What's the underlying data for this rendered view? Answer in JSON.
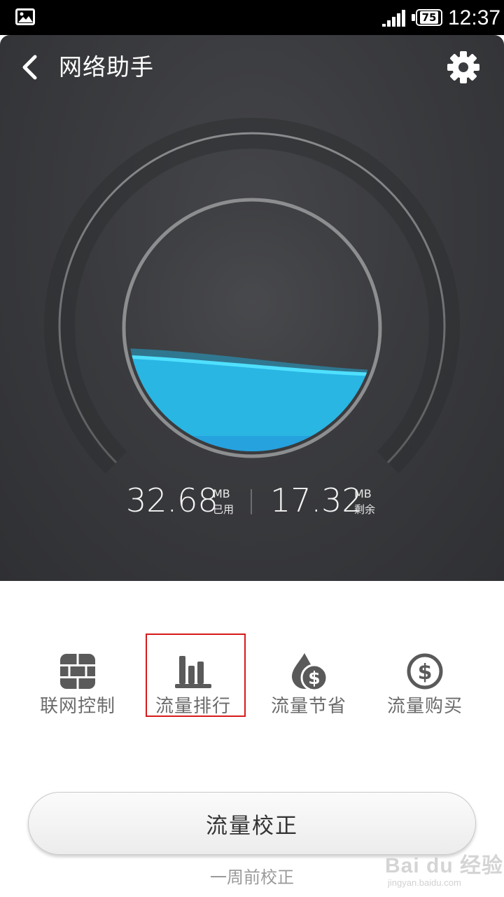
{
  "status_bar": {
    "time": "12:37",
    "battery": "75",
    "icons": [
      "image-notification-icon",
      "signal-icon",
      "battery-icon"
    ]
  },
  "header": {
    "title": "网络助手",
    "back_icon": "chevron-left-icon",
    "settings_icon": "gear-icon"
  },
  "usage": {
    "used_value": "32.68",
    "used_unit": "MB",
    "used_label": "已用",
    "remaining_value": "17.32",
    "remaining_unit": "MB",
    "remaining_label": "剩余",
    "fill_fraction": 0.35
  },
  "tools": [
    {
      "label": "联网控制",
      "icon": "firewall-icon"
    },
    {
      "label": "流量排行",
      "icon": "bar-chart-icon",
      "highlighted": true
    },
    {
      "label": "流量节省",
      "icon": "drop-dollar-icon"
    },
    {
      "label": "流量购买",
      "icon": "dollar-circle-icon"
    }
  ],
  "calibrate": {
    "button_label": "流量校正",
    "note": "一周前校正"
  },
  "watermark": {
    "main": "Bai du 经验",
    "sub": "jingyan.baidu.com"
  },
  "colors": {
    "dark_bg": "#3a3b3e",
    "water": "#29b6e3",
    "highlight": "#d61a1a",
    "tool_icon": "#555555"
  }
}
